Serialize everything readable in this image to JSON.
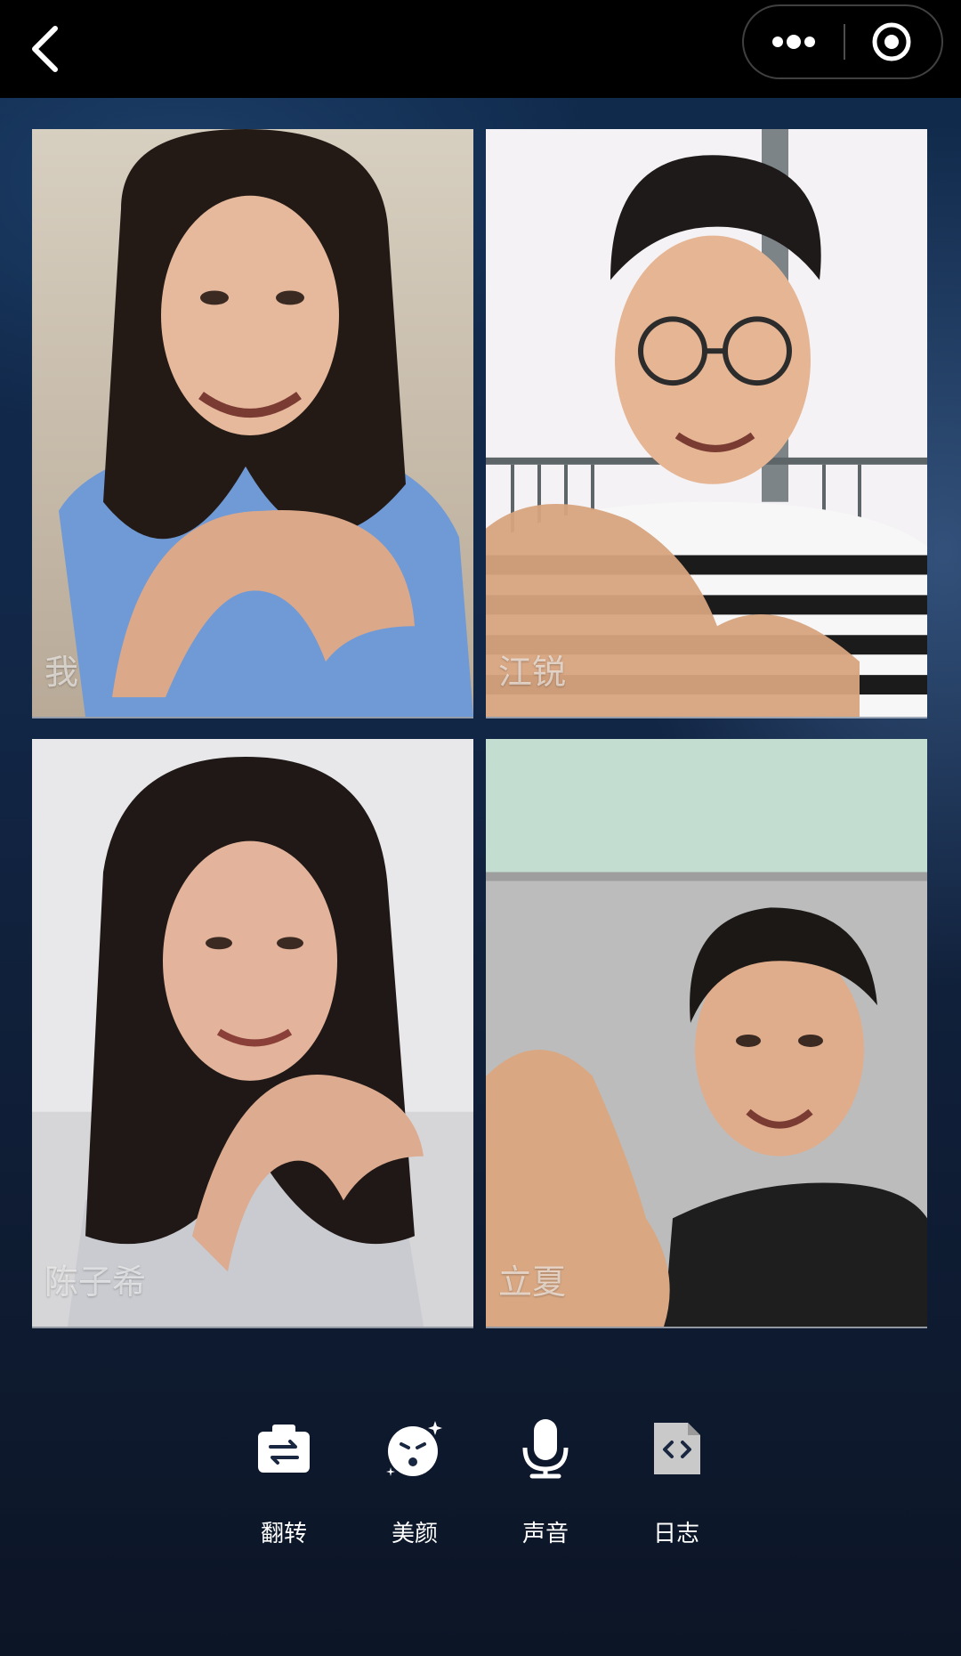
{
  "participants": [
    {
      "name": "我"
    },
    {
      "name": "江锐"
    },
    {
      "name": "陈子希"
    },
    {
      "name": "立夏"
    }
  ],
  "toolbar": {
    "items": [
      {
        "label": "翻转",
        "icon": "switch-camera-icon"
      },
      {
        "label": "美颜",
        "icon": "beauty-face-icon"
      },
      {
        "label": "声音",
        "icon": "microphone-icon"
      },
      {
        "label": "日志",
        "icon": "log-file-icon"
      }
    ]
  },
  "topbar": {
    "back_icon": "chevron-left-icon",
    "more_icon": "more-dots-icon",
    "record_icon": "record-target-icon"
  },
  "colors": {
    "topbar": "#000000",
    "background": "#10203a",
    "text": "#ffffff"
  }
}
